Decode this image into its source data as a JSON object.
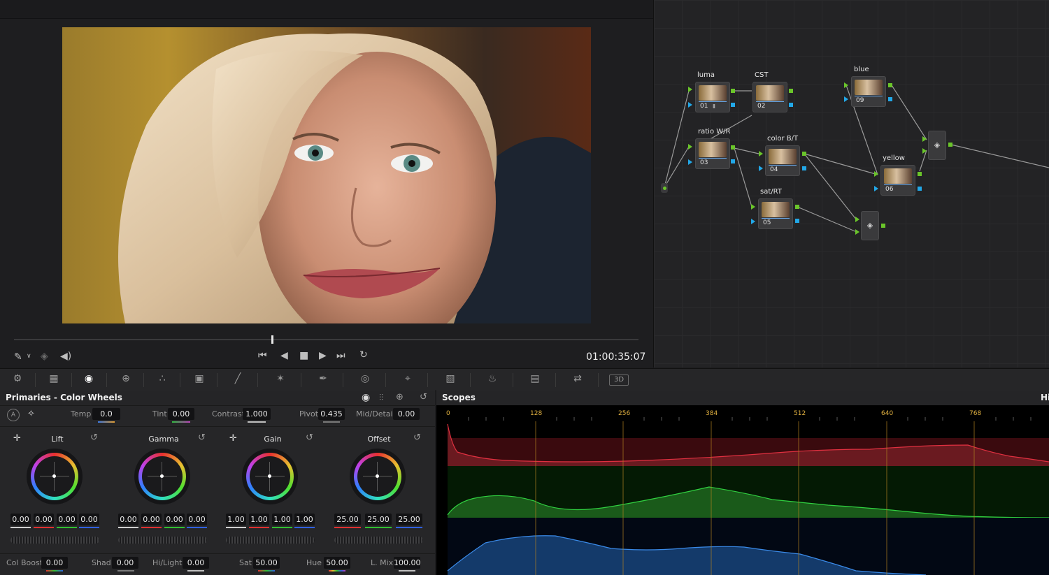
{
  "viewer": {
    "timecode": "01:00:35:07",
    "playhead_fraction": 0.413
  },
  "nodes": [
    {
      "id": "01",
      "label": "luma"
    },
    {
      "id": "02",
      "label": "CST"
    },
    {
      "id": "03",
      "label": "ratio W/R"
    },
    {
      "id": "04",
      "label": "color B/T"
    },
    {
      "id": "05",
      "label": "sat/RT"
    },
    {
      "id": "06",
      "label": "yellow"
    },
    {
      "id": "09",
      "label": "blue"
    }
  ],
  "primaries": {
    "title": "Primaries - Color Wheels",
    "top": {
      "temp_label": "Temp",
      "temp": "0.0",
      "tint_label": "Tint",
      "tint": "0.00",
      "contrast_label": "Contrast",
      "contrast": "1.000",
      "pivot_label": "Pivot",
      "pivot": "0.435",
      "mid_label": "Mid/Detail",
      "mid": "0.00"
    },
    "wheels": [
      {
        "name": "Lift",
        "values": [
          "0.00",
          "0.00",
          "0.00",
          "0.00"
        ]
      },
      {
        "name": "Gamma",
        "values": [
          "0.00",
          "0.00",
          "0.00",
          "0.00"
        ]
      },
      {
        "name": "Gain",
        "values": [
          "1.00",
          "1.00",
          "1.00",
          "1.00"
        ]
      },
      {
        "name": "Offset",
        "values": [
          "25.00",
          "25.00",
          "25.00"
        ]
      }
    ],
    "bottom": {
      "colboost_label": "Col Boost",
      "colboost": "0.00",
      "shad_label": "Shad",
      "shad": "0.00",
      "hilight_label": "Hi/Light",
      "hilight": "0.00",
      "sat_label": "Sat",
      "sat": "50.00",
      "hue_label": "Hue",
      "hue": "50.00",
      "lmix_label": "L. Mix",
      "lmix": "100.00"
    }
  },
  "scopes": {
    "title": "Scopes",
    "right_label": "Hi",
    "ticks": [
      "0",
      "128",
      "256",
      "384",
      "512",
      "640",
      "768"
    ]
  },
  "icons": {
    "viewer_controls": [
      "picker-icon",
      "layers-icon",
      "volume-icon",
      "skip-back-icon",
      "step-back-icon",
      "stop-icon",
      "play-icon",
      "skip-forward-icon",
      "loop-icon"
    ],
    "palette": [
      "camera-raw-icon",
      "color-match-icon",
      "color-wheels-icon",
      "hdr-icon",
      "rgb-mixer-icon",
      "motion-effects-icon",
      "curves-icon",
      "color-warper-icon",
      "qualifier-icon",
      "window-icon",
      "tracker-icon",
      "magic-mask-icon",
      "blur-icon",
      "key-icon",
      "sizing-icon",
      "3d-icon"
    ]
  }
}
